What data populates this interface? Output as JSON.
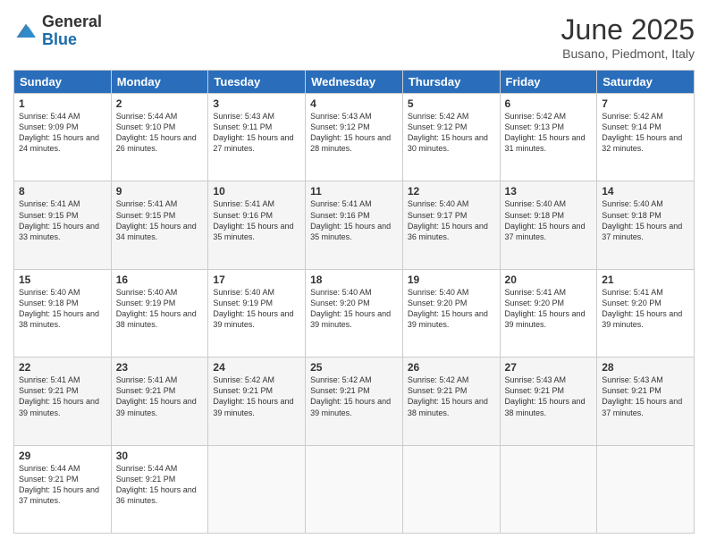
{
  "logo": {
    "general": "General",
    "blue": "Blue"
  },
  "title": "June 2025",
  "subtitle": "Busano, Piedmont, Italy",
  "days": [
    "Sunday",
    "Monday",
    "Tuesday",
    "Wednesday",
    "Thursday",
    "Friday",
    "Saturday"
  ],
  "weeks": [
    [
      {
        "num": "1",
        "sunrise": "5:44 AM",
        "sunset": "9:09 PM",
        "daylight": "15 hours and 24 minutes."
      },
      {
        "num": "2",
        "sunrise": "5:44 AM",
        "sunset": "9:10 PM",
        "daylight": "15 hours and 26 minutes."
      },
      {
        "num": "3",
        "sunrise": "5:43 AM",
        "sunset": "9:11 PM",
        "daylight": "15 hours and 27 minutes."
      },
      {
        "num": "4",
        "sunrise": "5:43 AM",
        "sunset": "9:12 PM",
        "daylight": "15 hours and 28 minutes."
      },
      {
        "num": "5",
        "sunrise": "5:42 AM",
        "sunset": "9:12 PM",
        "daylight": "15 hours and 30 minutes."
      },
      {
        "num": "6",
        "sunrise": "5:42 AM",
        "sunset": "9:13 PM",
        "daylight": "15 hours and 31 minutes."
      },
      {
        "num": "7",
        "sunrise": "5:42 AM",
        "sunset": "9:14 PM",
        "daylight": "15 hours and 32 minutes."
      }
    ],
    [
      {
        "num": "8",
        "sunrise": "5:41 AM",
        "sunset": "9:15 PM",
        "daylight": "15 hours and 33 minutes."
      },
      {
        "num": "9",
        "sunrise": "5:41 AM",
        "sunset": "9:15 PM",
        "daylight": "15 hours and 34 minutes."
      },
      {
        "num": "10",
        "sunrise": "5:41 AM",
        "sunset": "9:16 PM",
        "daylight": "15 hours and 35 minutes."
      },
      {
        "num": "11",
        "sunrise": "5:41 AM",
        "sunset": "9:16 PM",
        "daylight": "15 hours and 35 minutes."
      },
      {
        "num": "12",
        "sunrise": "5:40 AM",
        "sunset": "9:17 PM",
        "daylight": "15 hours and 36 minutes."
      },
      {
        "num": "13",
        "sunrise": "5:40 AM",
        "sunset": "9:18 PM",
        "daylight": "15 hours and 37 minutes."
      },
      {
        "num": "14",
        "sunrise": "5:40 AM",
        "sunset": "9:18 PM",
        "daylight": "15 hours and 37 minutes."
      }
    ],
    [
      {
        "num": "15",
        "sunrise": "5:40 AM",
        "sunset": "9:18 PM",
        "daylight": "15 hours and 38 minutes."
      },
      {
        "num": "16",
        "sunrise": "5:40 AM",
        "sunset": "9:19 PM",
        "daylight": "15 hours and 38 minutes."
      },
      {
        "num": "17",
        "sunrise": "5:40 AM",
        "sunset": "9:19 PM",
        "daylight": "15 hours and 39 minutes."
      },
      {
        "num": "18",
        "sunrise": "5:40 AM",
        "sunset": "9:20 PM",
        "daylight": "15 hours and 39 minutes."
      },
      {
        "num": "19",
        "sunrise": "5:40 AM",
        "sunset": "9:20 PM",
        "daylight": "15 hours and 39 minutes."
      },
      {
        "num": "20",
        "sunrise": "5:41 AM",
        "sunset": "9:20 PM",
        "daylight": "15 hours and 39 minutes."
      },
      {
        "num": "21",
        "sunrise": "5:41 AM",
        "sunset": "9:20 PM",
        "daylight": "15 hours and 39 minutes."
      }
    ],
    [
      {
        "num": "22",
        "sunrise": "5:41 AM",
        "sunset": "9:21 PM",
        "daylight": "15 hours and 39 minutes."
      },
      {
        "num": "23",
        "sunrise": "5:41 AM",
        "sunset": "9:21 PM",
        "daylight": "15 hours and 39 minutes."
      },
      {
        "num": "24",
        "sunrise": "5:42 AM",
        "sunset": "9:21 PM",
        "daylight": "15 hours and 39 minutes."
      },
      {
        "num": "25",
        "sunrise": "5:42 AM",
        "sunset": "9:21 PM",
        "daylight": "15 hours and 39 minutes."
      },
      {
        "num": "26",
        "sunrise": "5:42 AM",
        "sunset": "9:21 PM",
        "daylight": "15 hours and 38 minutes."
      },
      {
        "num": "27",
        "sunrise": "5:43 AM",
        "sunset": "9:21 PM",
        "daylight": "15 hours and 38 minutes."
      },
      {
        "num": "28",
        "sunrise": "5:43 AM",
        "sunset": "9:21 PM",
        "daylight": "15 hours and 37 minutes."
      }
    ],
    [
      {
        "num": "29",
        "sunrise": "5:44 AM",
        "sunset": "9:21 PM",
        "daylight": "15 hours and 37 minutes."
      },
      {
        "num": "30",
        "sunrise": "5:44 AM",
        "sunset": "9:21 PM",
        "daylight": "15 hours and 36 minutes."
      },
      null,
      null,
      null,
      null,
      null
    ]
  ]
}
